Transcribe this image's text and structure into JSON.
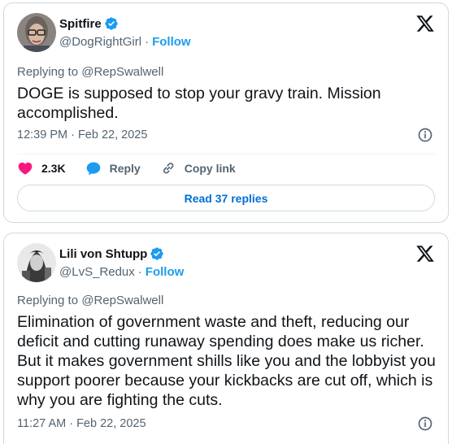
{
  "tweets": [
    {
      "name": "Spitfire",
      "handle": "@DogRightGirl",
      "follow": "Follow",
      "replying": "Replying to @RepSwalwell",
      "text": "DOGE is supposed to stop your gravy train. Mission accomplished.",
      "timestamp": "12:39 PM · Feb 22, 2025",
      "likes": "2.3K",
      "reply_label": "Reply",
      "copy_label": "Copy link",
      "read_replies": "Read 37 replies"
    },
    {
      "name": "Lili von Shtupp",
      "handle": "@LvS_Redux",
      "follow": "Follow",
      "replying": "Replying to @RepSwalwell",
      "text": "Elimination of government waste and theft, reducing our deficit and cutting runaway spending does make us richer. But it makes government shills like you and the lobbyist you support poorer because your kickbacks are cut off, which is why you are fighting the cuts.",
      "timestamp": "11:27 AM · Feb 22, 2025"
    }
  ],
  "colors": {
    "accent": "#1d9bf0",
    "like": "#f91880",
    "muted": "#536471",
    "text": "#0f1419"
  },
  "icons": [
    "verified-badge-icon",
    "x-logo-icon",
    "info-icon",
    "heart-icon",
    "reply-bubble-icon",
    "link-icon"
  ]
}
